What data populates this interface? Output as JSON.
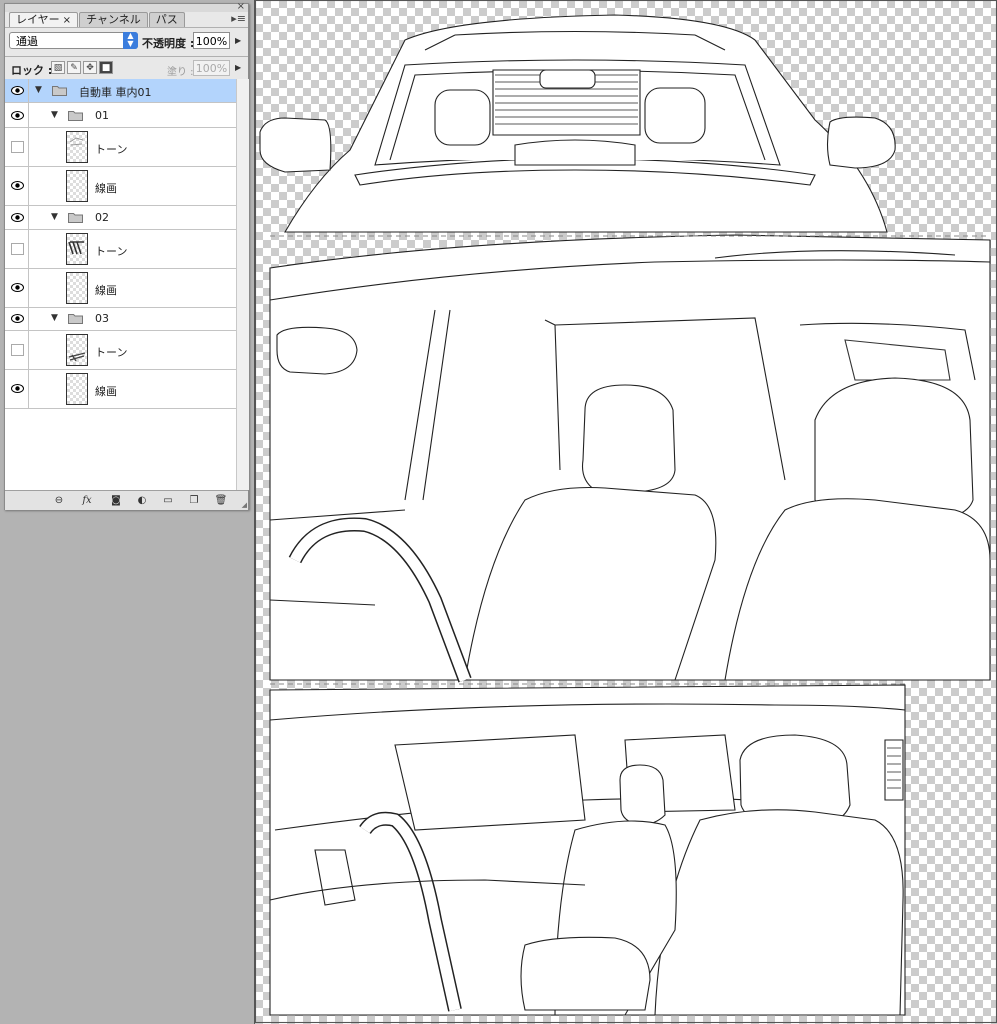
{
  "panel": {
    "tabs": [
      {
        "label": "レイヤー",
        "close": "×"
      },
      {
        "label": "チャンネル"
      },
      {
        "label": "パス"
      }
    ],
    "close_glyph": "×",
    "menu_glyph": "▸≡",
    "blend_mode": "通過",
    "opacity_label": "不透明度 :",
    "opacity_value": "100%",
    "lock_label": "ロック :",
    "fill_label": "塗り :",
    "fill_value": "100%"
  },
  "layers": [
    {
      "type": "group",
      "name": "自動車 車内01",
      "visible": true,
      "selected": true,
      "indent": 0
    },
    {
      "type": "group",
      "name": "01",
      "visible": true,
      "indent": 1
    },
    {
      "type": "layer",
      "name": "トーン",
      "visible": false,
      "indent": 2
    },
    {
      "type": "layer",
      "name": "線画",
      "visible": true,
      "indent": 2
    },
    {
      "type": "group",
      "name": "02",
      "visible": true,
      "indent": 1
    },
    {
      "type": "layer",
      "name": "トーン",
      "visible": false,
      "indent": 2
    },
    {
      "type": "layer",
      "name": "線画",
      "visible": true,
      "indent": 2
    },
    {
      "type": "group",
      "name": "03",
      "visible": true,
      "indent": 1
    },
    {
      "type": "layer",
      "name": "トーン",
      "visible": false,
      "indent": 2
    },
    {
      "type": "layer",
      "name": "線画",
      "visible": true,
      "indent": 2
    }
  ],
  "bottom_icons": [
    "link-icon",
    "fx-icon",
    "mask-icon",
    "adjustment-icon",
    "new-group-icon",
    "new-layer-icon",
    "trash-icon"
  ],
  "bottom_glyphs": {
    "fx": "fx"
  },
  "colors": {
    "selection": "#b3d4fc",
    "accent": "#3b7ddd"
  }
}
